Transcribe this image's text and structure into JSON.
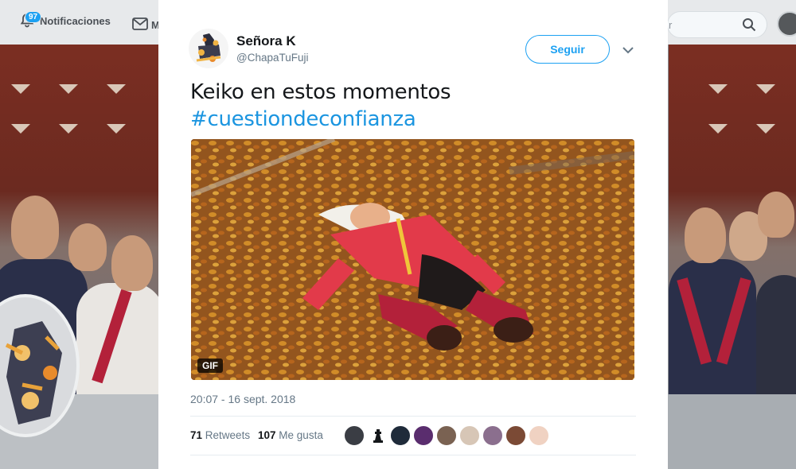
{
  "nav": {
    "notifications_label": "Notificaciones",
    "notifications_count": "97",
    "messages_label": "M",
    "search_placeholder": "r"
  },
  "tweet": {
    "author_name": "Señora K",
    "author_handle": "@ChapaTuFuji",
    "follow_label": "Seguir",
    "text": "Keiko en estos momentos",
    "hashtag": "#cuestiondeconfianza",
    "media_badge": "GIF",
    "timestamp": "20:07 - 16 sept. 2018",
    "retweets_count": "71",
    "retweets_label": "Retweets",
    "likes_count": "107",
    "likes_label": "Me gusta"
  },
  "colors": {
    "accent": "#1da1f2",
    "hashtag": "#1b95e0",
    "secondary_text": "#657786",
    "primary_text": "#14171a"
  },
  "icons": [
    "bell-icon",
    "mail-icon",
    "search-icon",
    "chevron-down-icon",
    "gif-badge"
  ]
}
